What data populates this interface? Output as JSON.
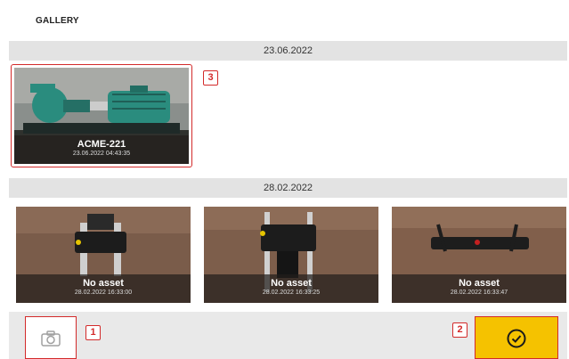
{
  "header": {
    "title": "GALLERY"
  },
  "groups": [
    {
      "date": "23.06.2022",
      "items": [
        {
          "name": "ACME-221",
          "timestamp": "23.06.2022 04:43:35"
        }
      ]
    },
    {
      "date": "28.02.2022",
      "items": [
        {
          "name": "No asset",
          "timestamp": "28.02.2022 16:33:00"
        },
        {
          "name": "No asset",
          "timestamp": "28.02.2022 16:33:25"
        },
        {
          "name": "No asset",
          "timestamp": "28.02.2022 16:33:47"
        }
      ]
    }
  ],
  "callouts": {
    "one": "1",
    "two": "2",
    "three": "3"
  },
  "footer": {
    "camera_icon": "camera-icon",
    "confirm_icon": "check-circle-icon"
  },
  "colors": {
    "accent": "#f5c200",
    "callout": "#d32a2a",
    "date_bar": "#e3e3e3"
  }
}
